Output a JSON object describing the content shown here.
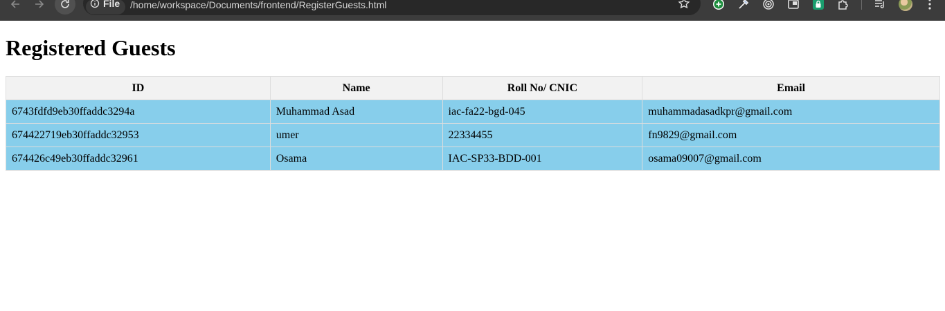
{
  "browser": {
    "site_chip_label": "File",
    "url": "/home/workspace/Documents/frontend/RegisterGuests.html",
    "icons": [
      "back-icon",
      "forward-icon",
      "reload-icon",
      "info-icon",
      "star-icon",
      "add-circle-icon",
      "eyedropper-icon",
      "target-icon",
      "picture-in-picture-icon",
      "lock-extension-icon",
      "puzzle-icon",
      "reading-list-icon",
      "avatar",
      "kebab-menu-icon"
    ]
  },
  "page": {
    "title": "Registered Guests"
  },
  "table": {
    "headers": [
      "ID",
      "Name",
      "Roll No/ CNIC",
      "Email"
    ],
    "rows": [
      [
        "6743fdfd9eb30ffaddc3294a",
        "Muhammad Asad",
        "iac-fa22-bgd-045",
        "muhammadasadkpr@gmail.com"
      ],
      [
        "674422719eb30ffaddc32953",
        "umer",
        "22334455",
        "fn9829@gmail.com"
      ],
      [
        "674426c49eb30ffaddc32961",
        "Osama",
        "IAC-SP33-BDD-001",
        "osama09007@gmail.com"
      ]
    ]
  },
  "colors": {
    "toolbar_bg": "#3c3c3c",
    "omnibox_bg": "#282828",
    "header_bg": "#f2f2f2",
    "row_bg": "#87ceeb",
    "border": "#dddddd"
  }
}
